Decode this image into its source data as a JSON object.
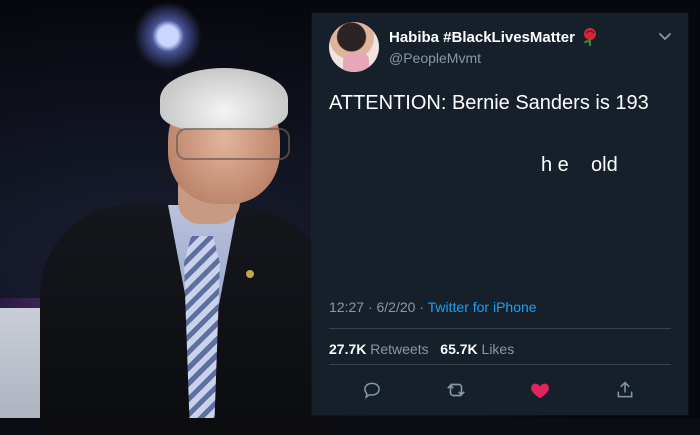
{
  "tweet": {
    "display_name": "Habiba #BlackLivesMatter",
    "handle": "@PeopleMvmt",
    "text_line1": "ATTENTION: Bernie Sanders is 193",
    "text_line2": "h e    old",
    "time": "12:27",
    "date": "6/2/20",
    "source": "Twitter for iPhone",
    "retweets_count": "27.7K",
    "retweets_label": "Retweets",
    "likes_count": "65.7K",
    "likes_label": "Likes"
  },
  "colors": {
    "card_bg": "#15202b",
    "secondary_text": "#8899a6",
    "link": "#1da1f2",
    "like_active": "#e0245e",
    "divider": "#38444d"
  },
  "icons": [
    "rose-emoji-icon",
    "chevron-down-icon",
    "reply-icon",
    "retweet-icon",
    "heart-icon",
    "share-icon"
  ]
}
